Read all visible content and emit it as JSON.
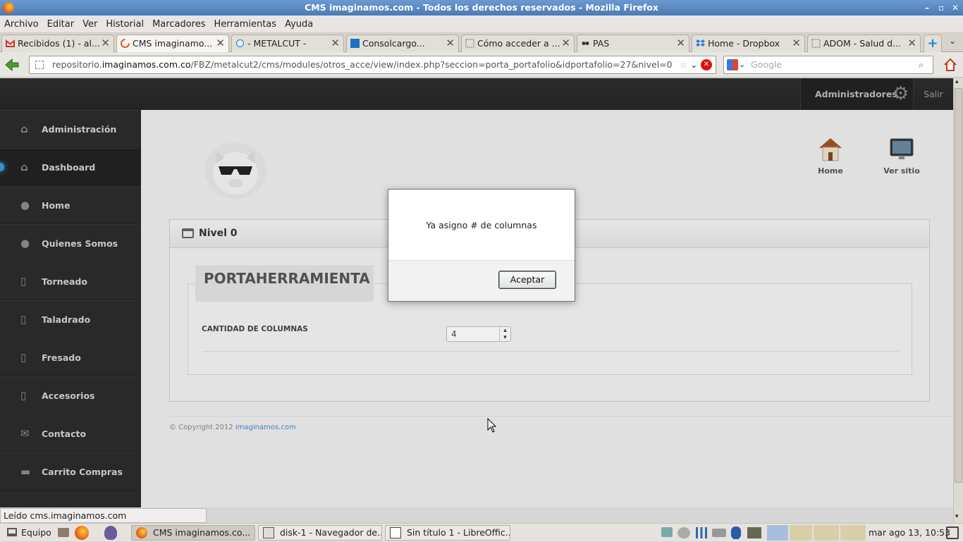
{
  "window": {
    "title": "CMS imaginamos.com - Todos los derechos reservados - Mozilla Firefox"
  },
  "menu": [
    "Archivo",
    "Editar",
    "Ver",
    "Historial",
    "Marcadores",
    "Herramientas",
    "Ayuda"
  ],
  "tabs": [
    {
      "label": "Recibidos (1) - al...",
      "icon": "gmail-icon"
    },
    {
      "label": "CMS imaginamo...",
      "icon": "loading-icon",
      "active": true
    },
    {
      "label": "- METALCUT -",
      "icon": "metalcut-icon"
    },
    {
      "label": "Consolcargo...",
      "icon": "consolcargo-icon"
    },
    {
      "label": "Cómo acceder a ...",
      "icon": "page-icon"
    },
    {
      "label": "PAS",
      "icon": "pas-icon"
    },
    {
      "label": "Home - Dropbox",
      "icon": "dropbox-icon"
    },
    {
      "label": "ADOM - Salud d...",
      "icon": "page-icon"
    }
  ],
  "address": {
    "prefix": "repositorio.",
    "domain": "imaginamos.com.co",
    "path": "/FBZ/metalcut2/cms/modules/otros_acce/view/index.php?seccion=porta_portafolio&idportafolio=27&nivel=0"
  },
  "search": {
    "placeholder": "Google"
  },
  "topnav": {
    "user": "Administradores",
    "logout": "Salir"
  },
  "sidebar": [
    {
      "label": "Administración",
      "icon": "home-icon"
    },
    {
      "label": "Dashboard",
      "icon": "home-icon",
      "active": true
    },
    {
      "label": "Home",
      "icon": "user-icon"
    },
    {
      "label": "Quienes Somos",
      "icon": "users-icon"
    },
    {
      "label": "Torneado",
      "icon": "clipboard-icon"
    },
    {
      "label": "Taladrado",
      "icon": "clipboard-icon"
    },
    {
      "label": "Fresado",
      "icon": "clipboard-icon"
    },
    {
      "label": "Accesorios",
      "icon": "clipboard-icon"
    },
    {
      "label": "Contacto",
      "icon": "mail-icon"
    },
    {
      "label": "Carrito Compras",
      "icon": "briefcase-icon"
    }
  ],
  "shortcuts": [
    {
      "label": "Home"
    },
    {
      "label": "Ver sitio"
    }
  ],
  "panel": {
    "title": "Nivel 0",
    "section_title": "PORTAHERRAMIENTA",
    "field_label": "CANTIDAD DE COLUMNAS",
    "field_value": "4"
  },
  "footer": {
    "copyright": "© Copyright 2012",
    "link": "imaginamos.com"
  },
  "dialog": {
    "message": "Ya asigno # de columnas",
    "button": "Aceptar"
  },
  "status_bar": "Leído cms.imaginamos.com",
  "taskbar": {
    "start": "Equipo",
    "windows": [
      {
        "label": "CMS imaginamos.co...",
        "active": true
      },
      {
        "label": "disk-1 - Navegador de..."
      },
      {
        "label": "Sin título 1 - LibreOffic..."
      }
    ],
    "clock": "mar ago 13, 10:53"
  },
  "colors": {
    "accent": "#4a86c8",
    "sidebar": "#2c2c2c",
    "topnav": "#2a2a2a"
  }
}
